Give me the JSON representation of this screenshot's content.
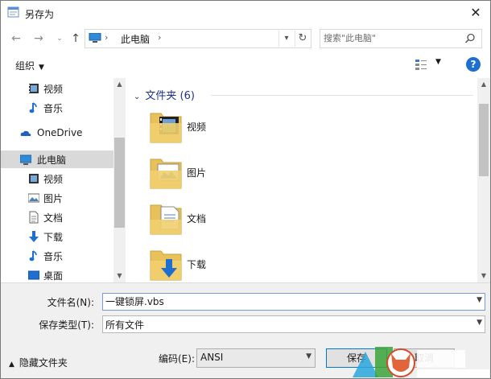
{
  "window": {
    "title": "另存为"
  },
  "address": {
    "path_label": "此电脑",
    "sep": "›",
    "search_placeholder": "搜索\"此电脑\""
  },
  "toolbar": {
    "organize_label": "组织"
  },
  "nav_pane": {
    "items": [
      {
        "label": "视频",
        "icon": "video-icon"
      },
      {
        "label": "音乐",
        "icon": "music-icon"
      },
      {
        "label": "OneDrive",
        "icon": "onedrive-icon"
      },
      {
        "label": "此电脑",
        "icon": "computer-icon",
        "selected": true
      },
      {
        "label": "视频",
        "icon": "video-icon"
      },
      {
        "label": "图片",
        "icon": "pictures-icon"
      },
      {
        "label": "文档",
        "icon": "documents-icon"
      },
      {
        "label": "下载",
        "icon": "downloads-icon"
      },
      {
        "label": "音乐",
        "icon": "music-icon"
      },
      {
        "label": "桌面",
        "icon": "desktop-icon"
      }
    ]
  },
  "content": {
    "group_header": "文件夹 (6)",
    "folders": [
      {
        "label": "视频",
        "icon": "video-folder-icon"
      },
      {
        "label": "图片",
        "icon": "pictures-folder-icon"
      },
      {
        "label": "文档",
        "icon": "documents-folder-icon"
      },
      {
        "label": "下载",
        "icon": "downloads-folder-icon"
      }
    ]
  },
  "form": {
    "filename_label": "文件名(N):",
    "filename_value": "一键锁屏.vbs",
    "filetype_label": "保存类型(T):",
    "filetype_value": "所有文件",
    "hide_folders_label": "隐藏文件夹",
    "encoding_label": "编码(E):",
    "encoding_value": "ANSI",
    "save_label": "保存",
    "cancel_label": "取消"
  },
  "colors": {
    "accent": "#0078d7",
    "group_header": "#1e3287",
    "folder": "#e8c15a"
  }
}
